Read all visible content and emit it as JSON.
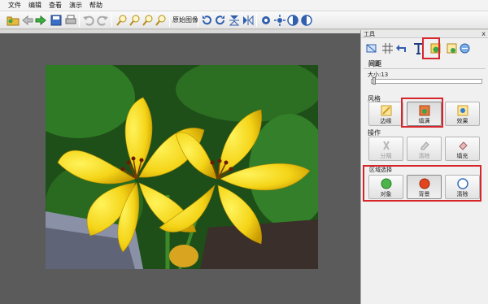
{
  "menu": [
    "文件",
    "编辑",
    "查看",
    "演示",
    "帮助"
  ],
  "toolbar": {
    "original_label": "原始图像"
  },
  "panel": {
    "title": "工具",
    "close": "x",
    "section_spacing": "间距",
    "size_label": "大小:13",
    "size_value": 13,
    "section_style": "风格",
    "style_buttons": [
      "边缘",
      "填满",
      "效果"
    ],
    "section_ops": "操作",
    "op_buttons": [
      "分隔",
      "清除",
      "填充"
    ],
    "section_select": "区域选择",
    "select_buttons": [
      "对象",
      "背景",
      "清除"
    ]
  },
  "colors": {
    "highlight": "#d7262b",
    "canvas_bg": "#5b5b5b"
  }
}
